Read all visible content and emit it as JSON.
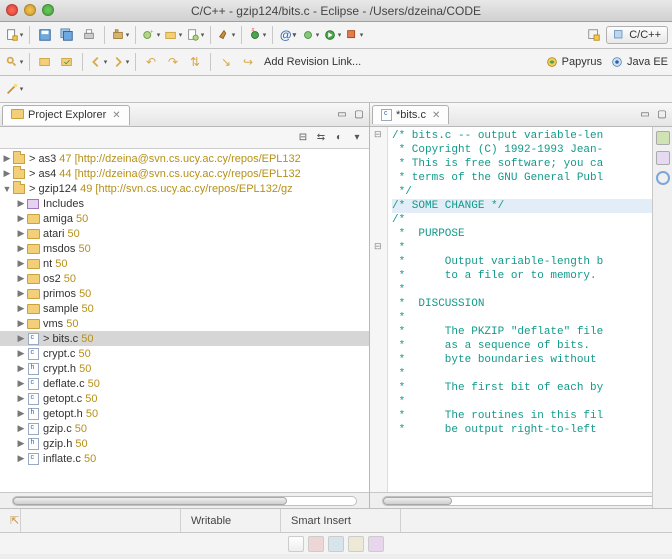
{
  "window": {
    "title": "C/C++ - gzip124/bits.c - Eclipse - /Users/dzeina/CODE"
  },
  "perspective": {
    "label": "C/C++"
  },
  "persp_extra": {
    "papyrus": "Papyrus",
    "javaee": "Java EE"
  },
  "toolbar2": {
    "add_revision": "Add Revision Link..."
  },
  "project_explorer": {
    "title": "Project Explorer"
  },
  "tree": {
    "projects": [
      {
        "name": "as3",
        "rev": "47",
        "repo": "[http://dzeina@svn.cs.ucy.ac.cy/repos/EPL132",
        "dirty": true
      },
      {
        "name": "as4",
        "rev": "44",
        "repo": "[http://dzeina@svn.cs.ucy.ac.cy/repos/EPL132",
        "dirty": true
      },
      {
        "name": "gzip124",
        "rev": "49",
        "repo": "[http://svn.cs.ucy.ac.cy/repos/EPL132/gz",
        "dirty": true,
        "expanded": true
      }
    ],
    "gzip_children": [
      {
        "icon": "inc",
        "label": "Includes",
        "rev": ""
      },
      {
        "icon": "fld",
        "label": "amiga",
        "rev": "50"
      },
      {
        "icon": "fld",
        "label": "atari",
        "rev": "50"
      },
      {
        "icon": "fld",
        "label": "msdos",
        "rev": "50"
      },
      {
        "icon": "fld",
        "label": "nt",
        "rev": "50"
      },
      {
        "icon": "fld",
        "label": "os2",
        "rev": "50"
      },
      {
        "icon": "fld",
        "label": "primos",
        "rev": "50"
      },
      {
        "icon": "fld",
        "label": "sample",
        "rev": "50"
      },
      {
        "icon": "fld",
        "label": "vms",
        "rev": "50"
      },
      {
        "icon": "c",
        "label": "bits.c",
        "rev": "50",
        "dirty": true,
        "selected": true
      },
      {
        "icon": "c",
        "label": "crypt.c",
        "rev": "50"
      },
      {
        "icon": "h",
        "label": "crypt.h",
        "rev": "50"
      },
      {
        "icon": "c",
        "label": "deflate.c",
        "rev": "50"
      },
      {
        "icon": "c",
        "label": "getopt.c",
        "rev": "50"
      },
      {
        "icon": "h",
        "label": "getopt.h",
        "rev": "50"
      },
      {
        "icon": "c",
        "label": "gzip.c",
        "rev": "50"
      },
      {
        "icon": "h",
        "label": "gzip.h",
        "rev": "50"
      },
      {
        "icon": "c",
        "label": "inflate.c",
        "rev": "50"
      }
    ]
  },
  "editor": {
    "tab_title": "*bits.c",
    "lines": [
      "/* bits.c -- output variable-len",
      " * Copyright (C) 1992-1993 Jean-",
      " * This is free software; you ca",
      " * terms of the GNU General Publ",
      " */",
      "",
      "/* SOME CHANGE */",
      "",
      "/*",
      " *  PURPOSE",
      " *",
      " *      Output variable-length b",
      " *      to a file or to memory.",
      " *",
      " *  DISCUSSION",
      " *",
      " *      The PKZIP \"deflate\" file",
      " *      as a sequence of bits.  ",
      " *      byte boundaries without ",
      " *",
      " *      The first bit of each by",
      " *",
      " *      The routines in this fil",
      " *      be output right-to-left "
    ],
    "highlight_index": 6
  },
  "status": {
    "writable": "Writable",
    "insert": "Smart Insert"
  }
}
